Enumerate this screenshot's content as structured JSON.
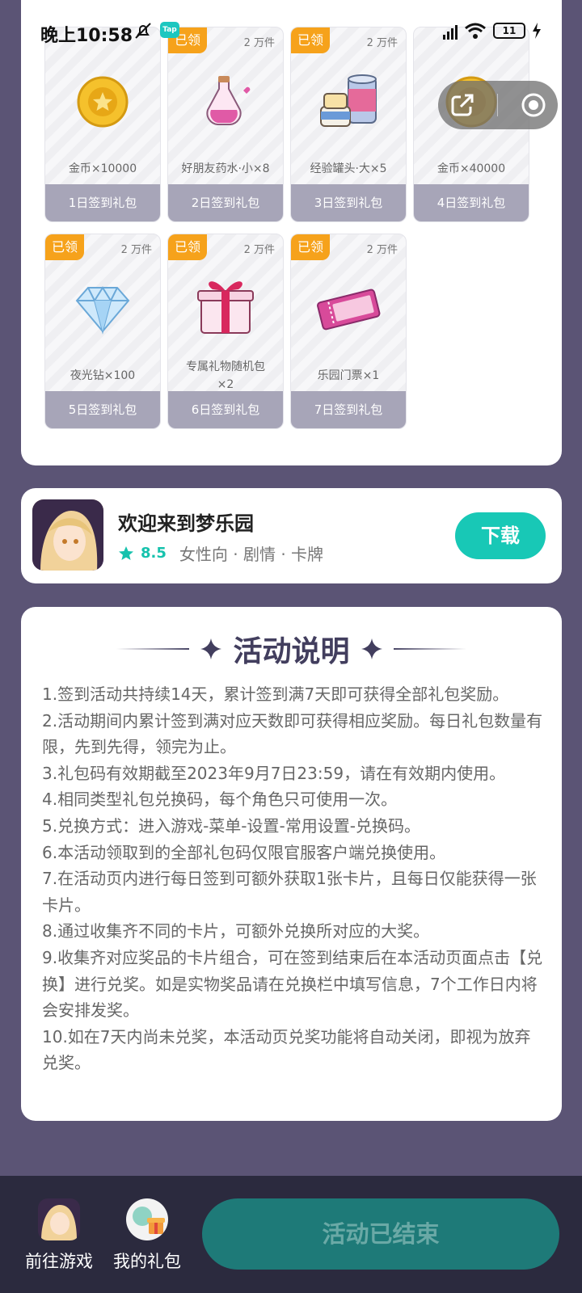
{
  "status_bar": {
    "time": "晚上10:58",
    "app_badge": "Tap",
    "battery": "11"
  },
  "gifts": [
    {
      "claimed": "",
      "stock": "",
      "name": "金币×10000",
      "day": "1日签到礼包",
      "icon": "gold-coin-icon"
    },
    {
      "claimed": "已领",
      "stock": "2 万件",
      "name": "好朋友药水·小×8",
      "day": "2日签到礼包",
      "icon": "potion-icon"
    },
    {
      "claimed": "已领",
      "stock": "2 万件",
      "name": "经验罐头·大×5",
      "day": "3日签到礼包",
      "icon": "cans-icon"
    },
    {
      "claimed": "",
      "stock": "",
      "name": "金币×40000",
      "day": "4日签到礼包",
      "icon": "gold-coin-icon"
    },
    {
      "claimed": "已领",
      "stock": "2 万件",
      "name": "夜光钻×100",
      "day": "5日签到礼包",
      "icon": "diamond-icon"
    },
    {
      "claimed": "已领",
      "stock": "2 万件",
      "name": "专属礼物随机包\n×2",
      "day": "6日签到礼包",
      "icon": "gift-box-icon"
    },
    {
      "claimed": "已领",
      "stock": "2 万件",
      "name": "乐园门票×1",
      "day": "7日签到礼包",
      "icon": "ticket-icon"
    }
  ],
  "game": {
    "title": "欢迎来到梦乐园",
    "rating": "8.5",
    "tags": "女性向 · 剧情 · 卡牌",
    "download_label": "下载"
  },
  "rules": {
    "title": "活动说明",
    "items": [
      "1.签到活动共持续14天，累计签到满7天即可获得全部礼包奖励。",
      "2.活动期间内累计签到满对应天数即可获得相应奖励。每日礼包数量有限，先到先得，领完为止。",
      "3.礼包码有效期截至2023年9月7日23:59，请在有效期内使用。",
      "4.相同类型礼包兑换码，每个角色只可使用一次。",
      "5.兑换方式：进入游戏-菜单-设置-常用设置-兑换码。",
      "6.本活动领取到的全部礼包码仅限官服客户端兑换使用。",
      "7.在活动页内进行每日签到可额外获取1张卡片，且每日仅能获得一张卡片。",
      "8.通过收集齐不同的卡片，可额外兑换所对应的大奖。",
      "9.收集齐对应奖品的卡片组合，可在签到结束后在本活动页面点击【兑换】进行兑奖。如是实物奖品请在兑换栏中填写信息，7个工作日内将会安排发奖。",
      "10.如在7天内尚未兑奖，本活动页兑奖功能将自动关闭，即视为放弃兑奖。"
    ]
  },
  "bottom": {
    "go_game": "前往游戏",
    "my_gifts": "我的礼包",
    "end_button": "活动已结束"
  },
  "colors": {
    "background": "#5b5475",
    "claimed_badge": "#f6a21b",
    "day_bar": "#a7a5b8",
    "accent": "#18c8b6",
    "end_button": "#1e7a78"
  }
}
